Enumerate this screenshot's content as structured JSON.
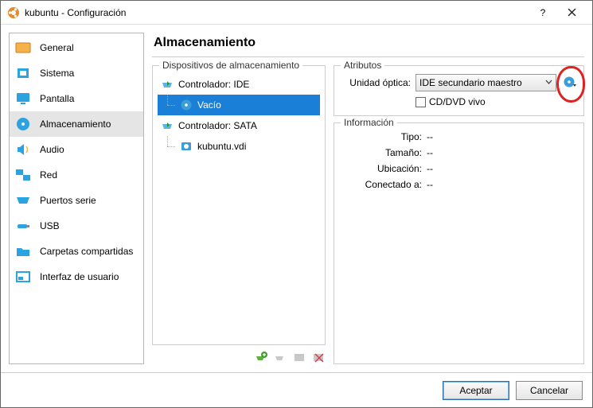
{
  "title": "kubuntu - Configuración",
  "sidebar": {
    "items": [
      {
        "label": "General"
      },
      {
        "label": "Sistema"
      },
      {
        "label": "Pantalla"
      },
      {
        "label": "Almacenamiento"
      },
      {
        "label": "Audio"
      },
      {
        "label": "Red"
      },
      {
        "label": "Puertos serie"
      },
      {
        "label": "USB"
      },
      {
        "label": "Carpetas compartidas"
      },
      {
        "label": "Interfaz de usuario"
      }
    ]
  },
  "heading": "Almacenamiento",
  "storage": {
    "legend": "Dispositivos de almacenamiento",
    "tree": {
      "controller_ide": "Controlador: IDE",
      "empty": "Vacío",
      "controller_sata": "Controlador: SATA",
      "disk": "kubuntu.vdi"
    }
  },
  "attributes": {
    "legend": "Atributos",
    "optical_label": "Unidad óptica:",
    "optical_value": "IDE secundario maestro",
    "live_label": "CD/DVD vivo"
  },
  "info": {
    "legend": "Información",
    "rows": {
      "tipo": {
        "label": "Tipo:",
        "value": "--"
      },
      "tamano": {
        "label": "Tamaño:",
        "value": "--"
      },
      "ubicacion": {
        "label": "Ubicación:",
        "value": "--"
      },
      "conectado": {
        "label": "Conectado a:",
        "value": "--"
      }
    }
  },
  "buttons": {
    "accept": "Aceptar",
    "cancel": "Cancelar"
  }
}
